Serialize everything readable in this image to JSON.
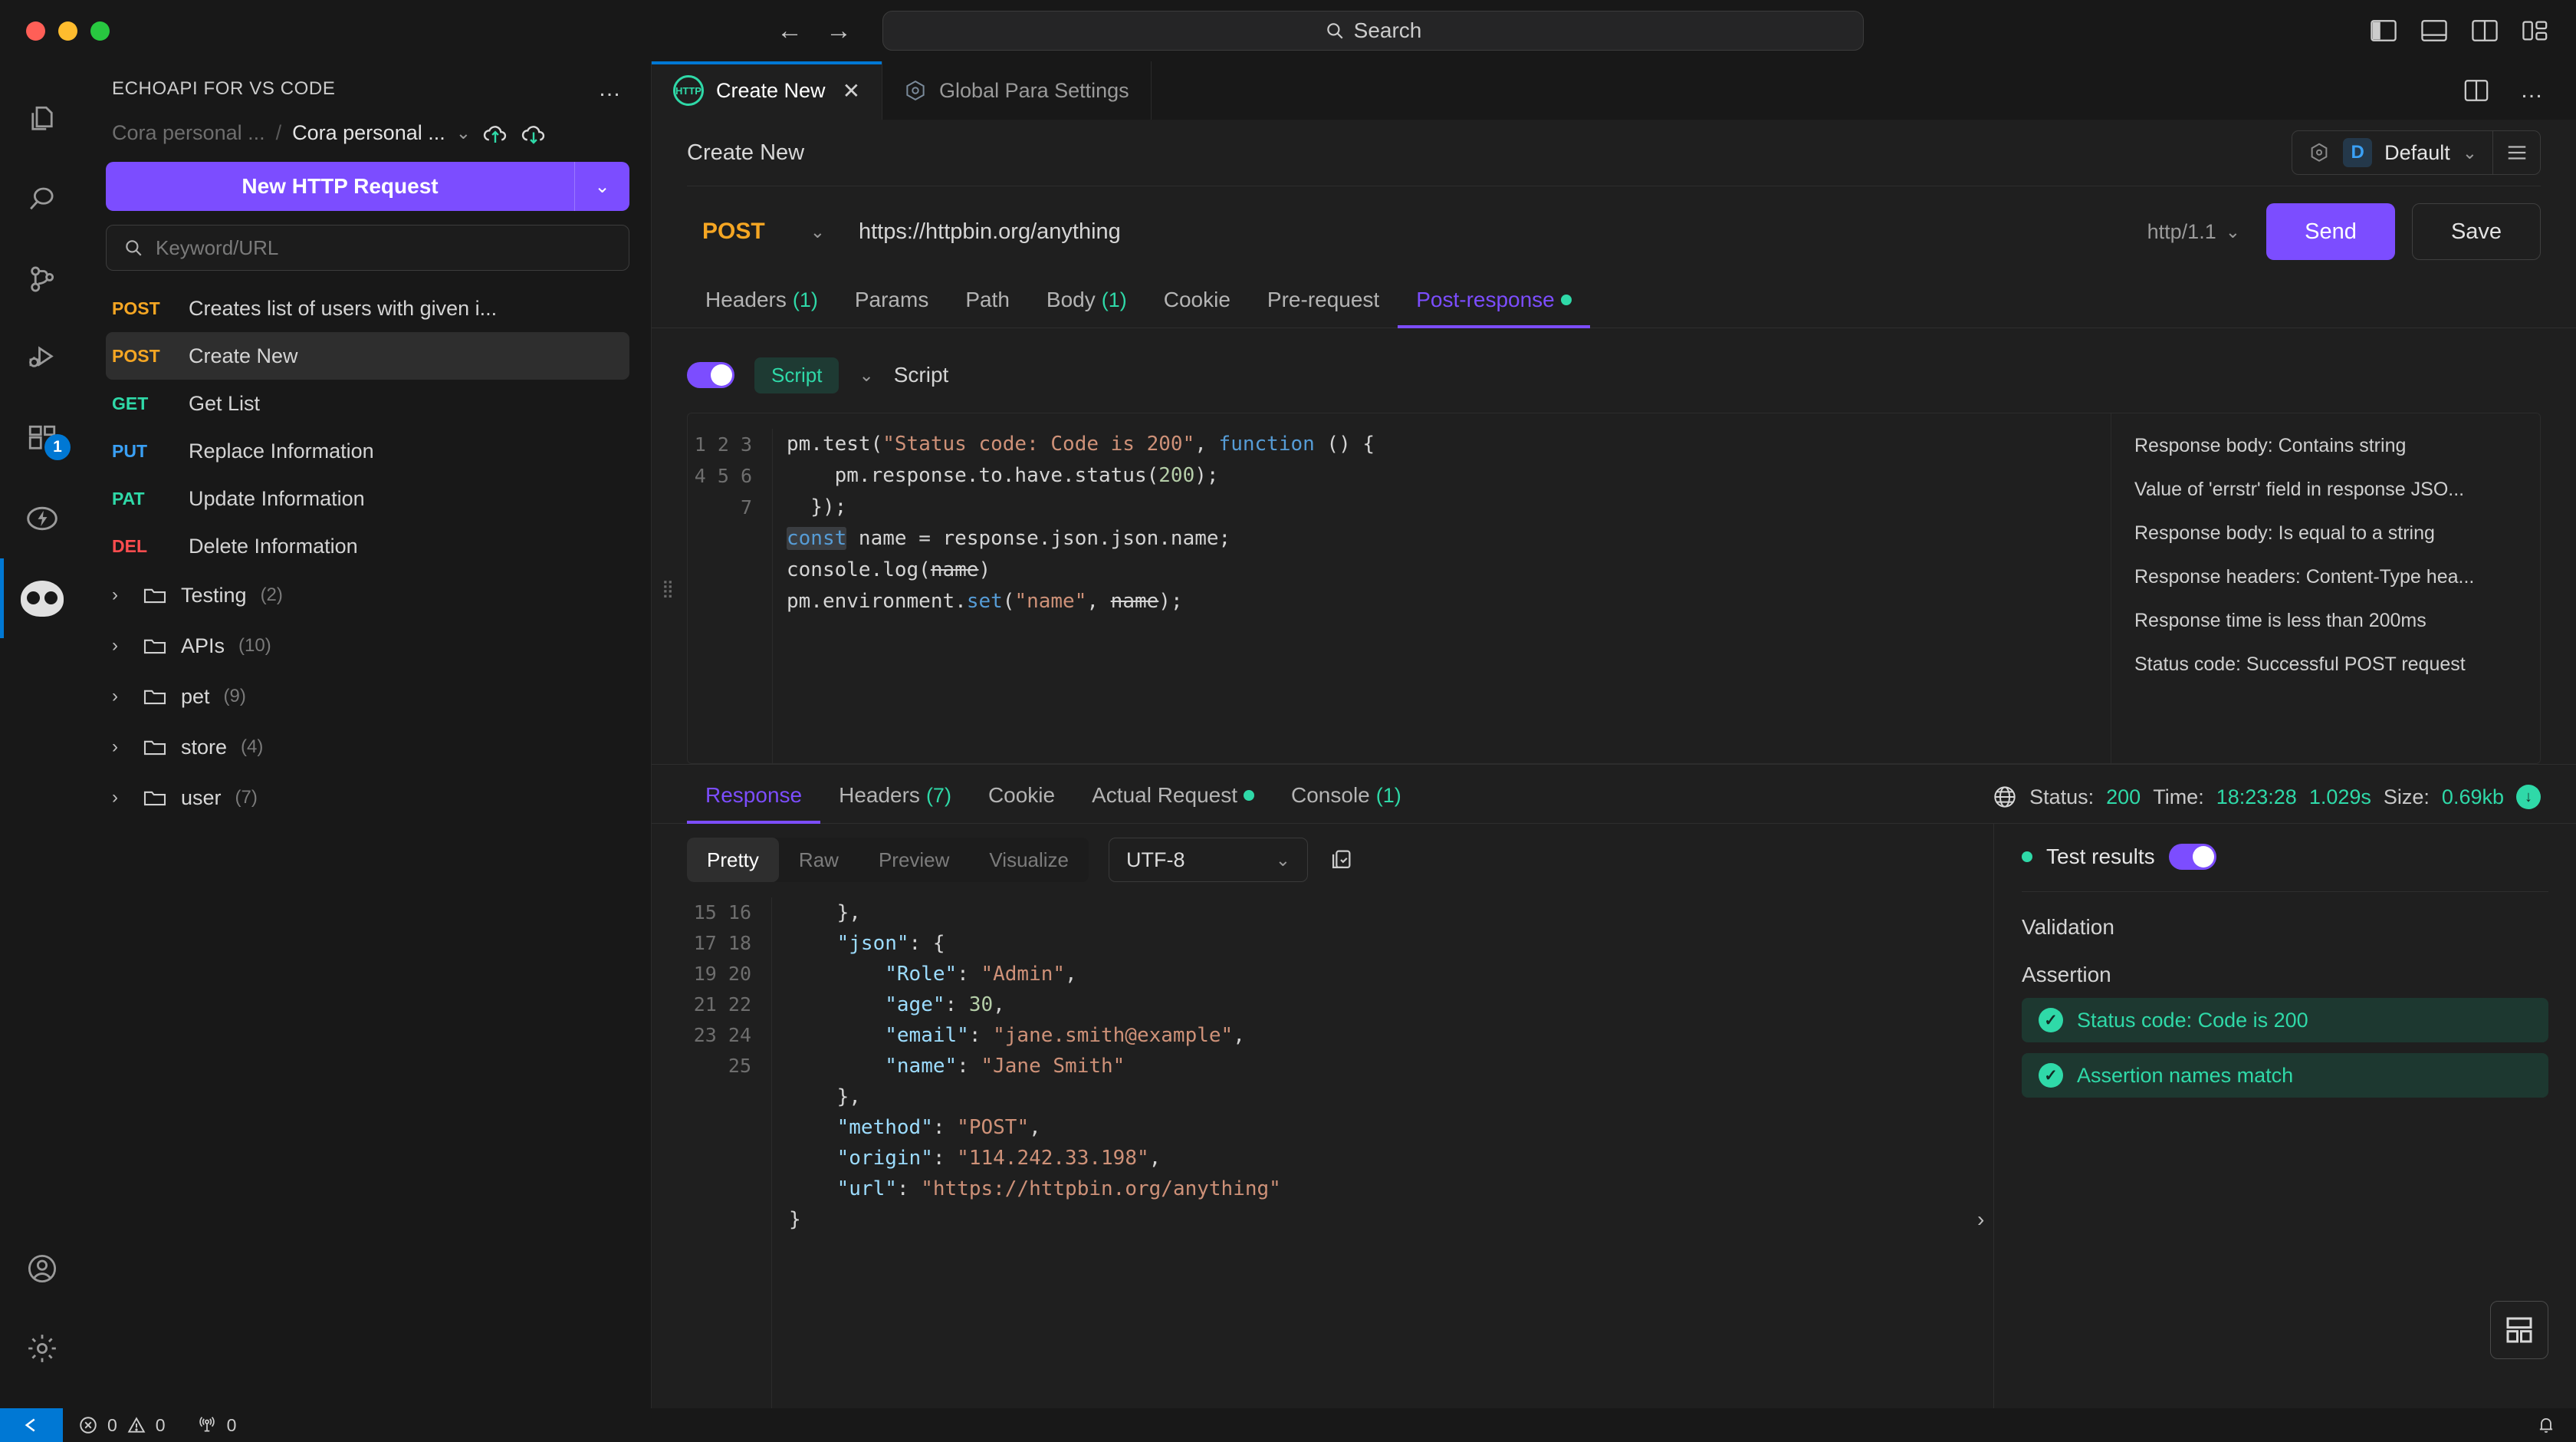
{
  "titlebar": {
    "search_placeholder": "Search",
    "search_icon": "search-icon",
    "back_icon": "←",
    "forward_icon": "→"
  },
  "activitybar": {
    "items": [
      {
        "name": "explorer",
        "icon": "files-icon"
      },
      {
        "name": "search",
        "icon": "search-icon"
      },
      {
        "name": "source-control",
        "icon": "source-control-icon"
      },
      {
        "name": "run-debug",
        "icon": "run-and-debug-icon"
      },
      {
        "name": "extensions",
        "icon": "extensions-icon",
        "badge": "1"
      },
      {
        "name": "thunder",
        "icon": "lightning-icon"
      },
      {
        "name": "echoapi",
        "icon": "owl-icon",
        "active": true
      }
    ],
    "bottom_items": [
      {
        "name": "accounts",
        "icon": "account-icon"
      },
      {
        "name": "settings",
        "icon": "gear-icon"
      }
    ]
  },
  "sidebar": {
    "title": "ECHOAPI FOR VS CODE",
    "more_icon": "ellipsis-icon",
    "breadcrumb": {
      "workspace": "Cora personal ...",
      "separator": "/",
      "project": "Cora personal ...",
      "caret": "⌄",
      "upload_icon": "cloud-upload-icon",
      "download_icon": "cloud-download-icon"
    },
    "new_request_button": "New HTTP Request",
    "new_request_caret": "⌄",
    "keyword_placeholder": "Keyword/URL",
    "search_icon": "search-icon",
    "requests": [
      {
        "method": "POST",
        "name": "Creates list of users with given i...",
        "selected": false
      },
      {
        "method": "POST",
        "name": "Create New",
        "selected": true
      },
      {
        "method": "GET",
        "name": "Get List",
        "selected": false
      },
      {
        "method": "PUT",
        "name": "Replace Information",
        "selected": false
      },
      {
        "method": "PAT",
        "name": "Update Information",
        "selected": false
      },
      {
        "method": "DEL",
        "name": "Delete Information",
        "selected": false
      }
    ],
    "folders": [
      {
        "name": "Testing",
        "count": "(2)"
      },
      {
        "name": "APIs",
        "count": "(10)"
      },
      {
        "name": "pet",
        "count": "(9)"
      },
      {
        "name": "store",
        "count": "(4)"
      },
      {
        "name": "user",
        "count": "(7)"
      }
    ]
  },
  "editor": {
    "tabs": [
      {
        "label": "Create New",
        "icon": "http-icon",
        "active": true,
        "closable": true
      },
      {
        "label": "Global Para Settings",
        "icon": "target-icon",
        "active": false,
        "closable": false
      }
    ],
    "tab_close": "✕",
    "split_icon": "split-editor-icon",
    "more_icon": "ellipsis-icon",
    "request_title": "Create New",
    "environment": {
      "icon": "hexagon-icon",
      "badge": "D",
      "name": "Default",
      "caret": "⌄",
      "menu_icon": "hamburger-icon"
    },
    "url_bar": {
      "method": "POST",
      "method_caret": "⌄",
      "url": "https://httpbin.org/anything",
      "http_version": "http/1.1",
      "http_version_caret": "⌄",
      "send_label": "Send",
      "save_label": "Save"
    },
    "request_tabs": [
      {
        "label": "Headers",
        "count": "(1)",
        "active": false,
        "dot": false
      },
      {
        "label": "Params",
        "count": "",
        "active": false,
        "dot": false
      },
      {
        "label": "Path",
        "count": "",
        "active": false,
        "dot": false
      },
      {
        "label": "Body",
        "count": "(1)",
        "active": false,
        "dot": false
      },
      {
        "label": "Cookie",
        "count": "",
        "active": false,
        "dot": false
      },
      {
        "label": "Pre-request",
        "count": "",
        "active": false,
        "dot": false
      },
      {
        "label": "Post-response",
        "count": "",
        "active": true,
        "dot": true
      }
    ],
    "script": {
      "toggle_on": true,
      "chip_label": "Script",
      "chip_caret": "⌄",
      "title": "Script",
      "line_numbers": [
        "1",
        "2",
        "3",
        "4",
        "5",
        "6",
        "7"
      ],
      "code_lines": [
        "pm.test(\"Status code: Code is 200\", function () {",
        "    pm.response.to.have.status(200);",
        "  });",
        "const name = response.json.json.name;",
        "console.log(name)",
        "pm.environment.set(\"name\", name);",
        ""
      ],
      "snippets": [
        "Response body: Contains string",
        "Value of 'errstr' field in response JSO...",
        "Response body: Is equal to a string",
        "Response headers: Content-Type hea...",
        "Response time is less than 200ms",
        "Status code: Successful POST request"
      ]
    }
  },
  "response": {
    "tabs": [
      {
        "label": "Response",
        "count": "",
        "active": true,
        "dot": false
      },
      {
        "label": "Headers",
        "count": "(7)",
        "active": false,
        "dot": false
      },
      {
        "label": "Cookie",
        "count": "",
        "active": false,
        "dot": false
      },
      {
        "label": "Actual Request",
        "count": "",
        "active": false,
        "dot": true
      },
      {
        "label": "Console",
        "count": "(1)",
        "active": false,
        "dot": false
      }
    ],
    "status": {
      "globe_icon": "globe-icon",
      "status_label": "Status:",
      "status_value": "200",
      "time_label": "Time:",
      "time_value": "18:23:28",
      "duration_value": "1.029s",
      "size_label": "Size:",
      "size_value": "0.69kb",
      "download_icon": "download-icon"
    },
    "format_tabs": [
      {
        "label": "Pretty",
        "active": true
      },
      {
        "label": "Raw",
        "active": false
      },
      {
        "label": "Preview",
        "active": false
      },
      {
        "label": "Visualize",
        "active": false
      }
    ],
    "encoding": "UTF-8",
    "encoding_caret": "⌄",
    "copy_icon": "copy-icon",
    "body_line_numbers": [
      "15",
      "16",
      "17",
      "18",
      "19",
      "20",
      "21",
      "22",
      "23",
      "24",
      "25"
    ],
    "body_lines": [
      "    },",
      "    \"json\": {",
      "        \"Role\": \"Admin\",",
      "        \"age\": 30,",
      "        \"email\": \"jane.smith@example\",",
      "        \"name\": \"Jane Smith\"",
      "    },",
      "    \"method\": \"POST\",",
      "    \"origin\": \"114.242.33.198\",",
      "    \"url\": \"https://httpbin.org/anything\"",
      "}"
    ],
    "test_results": {
      "title": "Test results",
      "toggle_on": true,
      "status_dot_color": "#2fd9a8",
      "validation_label": "Validation",
      "assertion_label": "Assertion",
      "assertions": [
        {
          "text": "Status code: Code is 200",
          "passed": true
        },
        {
          "text": "Assertion names match",
          "passed": true
        }
      ],
      "collapse_icon": "chevron-right-icon",
      "layout_icon": "layout-grid-icon"
    }
  },
  "statusbar": {
    "remote_icon": "remote-window-icon",
    "errors_icon": "error-icon",
    "errors": "0",
    "warnings_icon": "warning-icon",
    "warnings": "0",
    "ports_icon": "radio-tower-icon",
    "ports": "0",
    "bell_icon": "bell-icon"
  },
  "colors": {
    "accent_purple": "#7c4dff",
    "accent_green": "#2fd9a8",
    "accent_blue": "#0078d4",
    "method_post": "#f5a623",
    "method_get": "#2fd9a8",
    "method_put": "#3aa0f5",
    "method_del": "#ff4d4f"
  }
}
